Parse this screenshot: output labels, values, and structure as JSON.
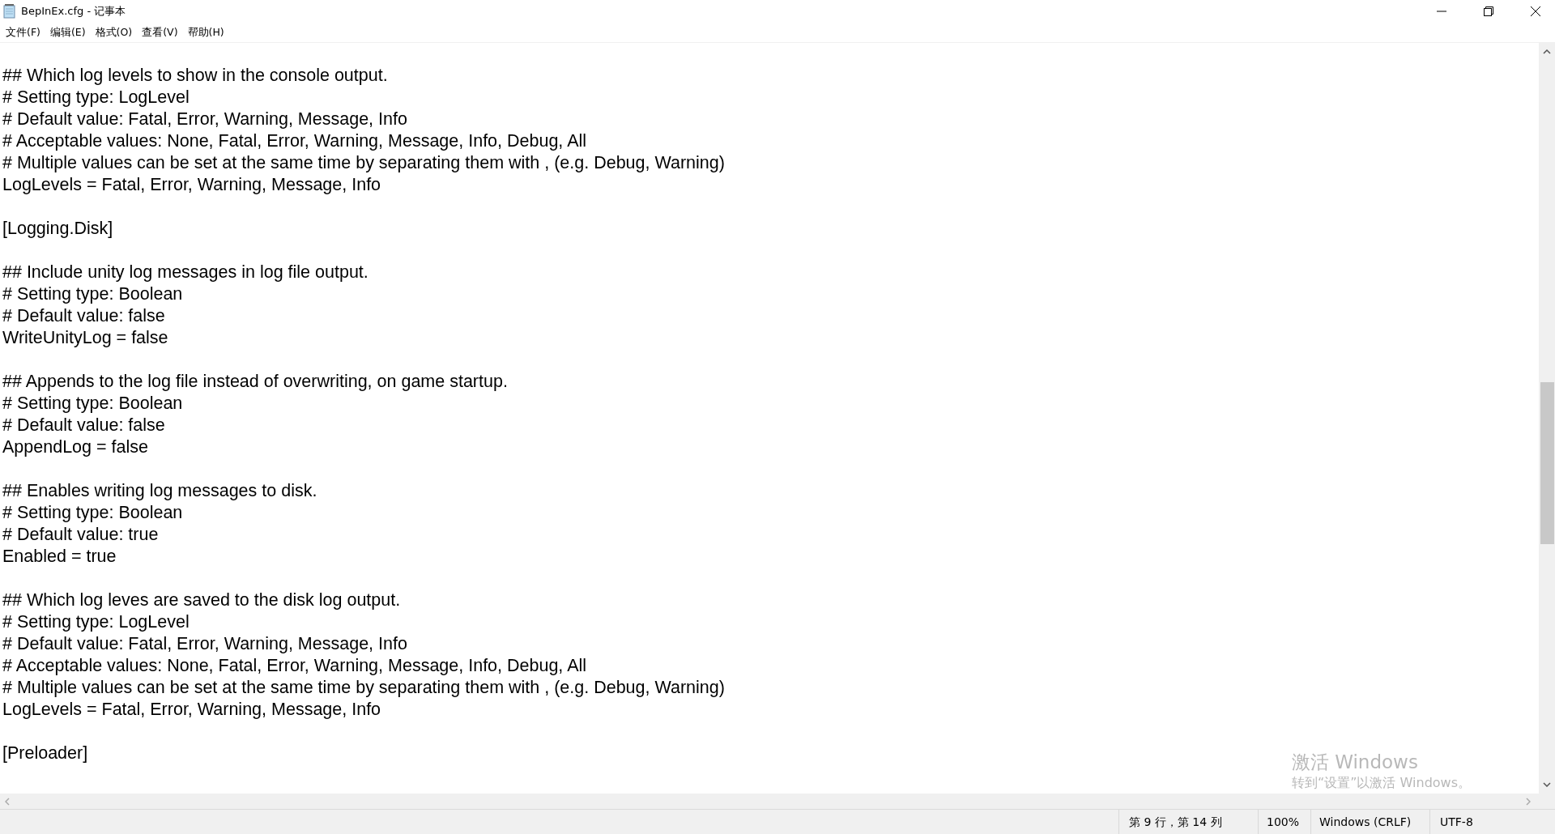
{
  "window": {
    "title": "BepInEx.cfg - 记事本"
  },
  "menu": [
    "文件(F)",
    "编辑(E)",
    "格式(O)",
    "查看(V)",
    "帮助(H)"
  ],
  "blocks": [
    [
      "## Which log levels to show in the console output.",
      "# Setting type: LogLevel",
      "# Default value: Fatal, Error, Warning, Message, Info",
      "# Acceptable values: None, Fatal, Error, Warning, Message, Info, Debug, All",
      "# Multiple values can be set at the same time by separating them with , (e.g. Debug, Warning)",
      "LogLevels = Fatal, Error, Warning, Message, Info"
    ],
    [
      "[Logging.Disk]"
    ],
    [
      "## Include unity log messages in log file output.",
      "# Setting type: Boolean",
      "# Default value: false",
      "WriteUnityLog = false"
    ],
    [
      "## Appends to the log file instead of overwriting, on game startup.",
      "# Setting type: Boolean",
      "# Default value: false",
      "AppendLog = false"
    ],
    [
      "## Enables writing log messages to disk.",
      "# Setting type: Boolean",
      "# Default value: true",
      "Enabled = true"
    ],
    [
      "## Which log leves are saved to the disk log output.",
      "# Setting type: LogLevel",
      "# Default value: Fatal, Error, Warning, Message, Info",
      "# Acceptable values: None, Fatal, Error, Warning, Message, Info, Debug, All",
      "# Multiple values can be set at the same time by separating them with , (e.g. Debug, Warning)",
      "LogLevels = Fatal, Error, Warning, Message, Info"
    ],
    [
      "[Preloader]"
    ]
  ],
  "activation": {
    "title": "激活 Windows",
    "hint": "转到“设置”以激活 Windows。"
  },
  "status_bar": [
    "第 9 行，第 14 列",
    "100%",
    "Windows (CRLF)",
    "UTF-8"
  ]
}
